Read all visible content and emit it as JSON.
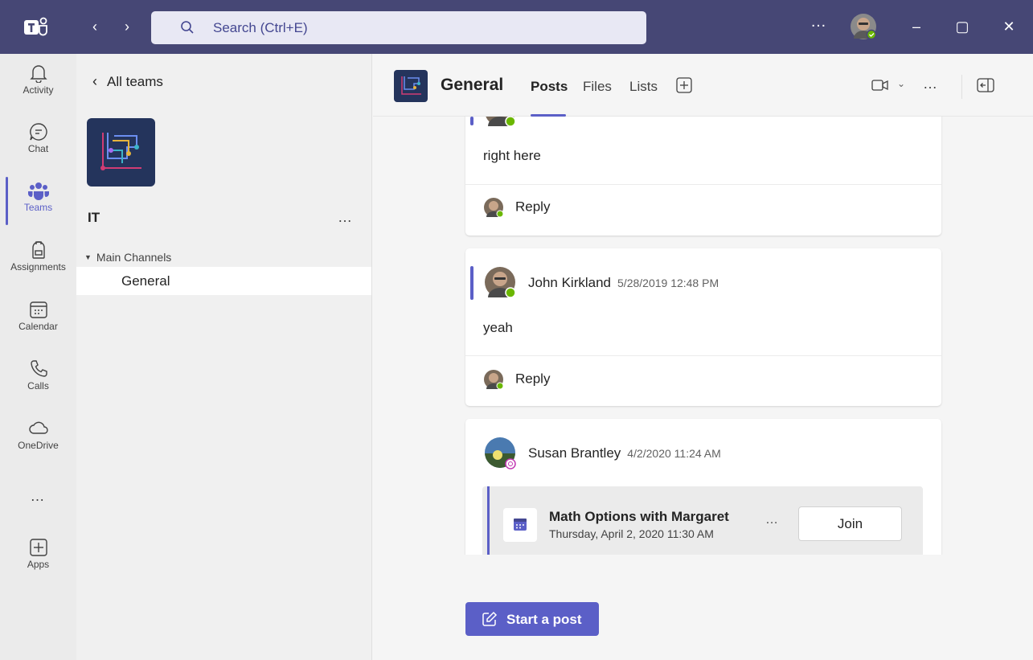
{
  "titlebar": {
    "search_placeholder": "Search (Ctrl+E)",
    "more_label": "…",
    "back_glyph": "‹",
    "forward_glyph": "›",
    "minimize_glyph": "–",
    "maximize_glyph": "▢",
    "close_glyph": "✕",
    "bg_color": "#464775"
  },
  "rail": {
    "items": [
      {
        "label": "Activity",
        "icon": "bell-icon"
      },
      {
        "label": "Chat",
        "icon": "chat-icon"
      },
      {
        "label": "Teams",
        "icon": "teams-icon",
        "active": true
      },
      {
        "label": "Assignments",
        "icon": "backpack-icon"
      },
      {
        "label": "Calendar",
        "icon": "calendar-icon"
      },
      {
        "label": "Calls",
        "icon": "phone-icon"
      },
      {
        "label": "OneDrive",
        "icon": "cloud-icon"
      }
    ],
    "more_label": "…",
    "apps_label": "Apps"
  },
  "panel": {
    "back_label": "All teams",
    "team_name": "IT",
    "team_more": "…",
    "section_label": "Main Channels",
    "channels": [
      "General"
    ]
  },
  "channel": {
    "name": "General",
    "tabs": [
      "Posts",
      "Files",
      "Lists"
    ],
    "active_tab": "Posts",
    "more_label": "…",
    "accent_color": "#5b5fc7"
  },
  "posts": [
    {
      "author": "",
      "timestamp": "",
      "body": "right here",
      "reply_label": "Reply"
    },
    {
      "author": "John Kirkland",
      "timestamp": "5/28/2019 12:48 PM",
      "body": "yeah",
      "reply_label": "Reply"
    },
    {
      "author": "Susan Brantley",
      "timestamp": "4/2/2020 11:24 AM",
      "meeting": {
        "title": "Math Options with Margaret",
        "time": "Thursday, April 2, 2020 11:30 AM",
        "more": "…",
        "join_label": "Join"
      }
    }
  ],
  "composer": {
    "start_post_label": "Start a post"
  }
}
